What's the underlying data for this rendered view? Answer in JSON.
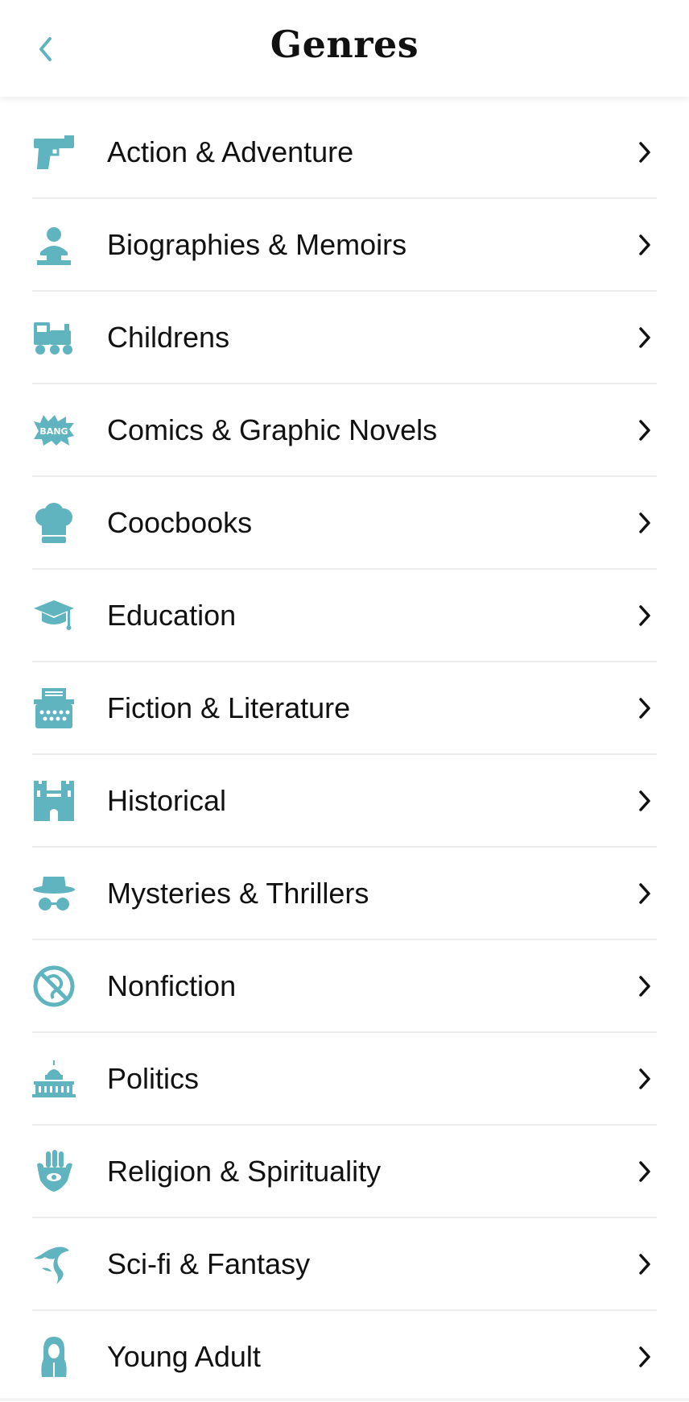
{
  "header": {
    "title": "Genres"
  },
  "colors": {
    "accent": "#5fb4bf",
    "text": "#111111",
    "divider": "#ececec"
  },
  "genres": [
    {
      "label": "Action & Adventure",
      "icon": "gun-icon"
    },
    {
      "label": "Biographies & Memoirs",
      "icon": "bust-icon"
    },
    {
      "label": "Childrens",
      "icon": "toy-train-icon"
    },
    {
      "label": "Comics & Graphic Novels",
      "icon": "bang-icon"
    },
    {
      "label": "Coocbooks",
      "icon": "chef-hat-icon"
    },
    {
      "label": "Education",
      "icon": "graduation-cap-icon"
    },
    {
      "label": "Fiction & Literature",
      "icon": "typewriter-icon"
    },
    {
      "label": "Historical",
      "icon": "castle-icon"
    },
    {
      "label": "Mysteries & Thrillers",
      "icon": "detective-icon"
    },
    {
      "label": "Nonfiction",
      "icon": "no-dragon-icon"
    },
    {
      "label": "Politics",
      "icon": "capitol-icon"
    },
    {
      "label": "Religion & Spirituality",
      "icon": "hamsa-icon"
    },
    {
      "label": "Sci-fi & Fantasy",
      "icon": "dragon-icon"
    },
    {
      "label": "Young Adult",
      "icon": "hooded-teen-icon"
    }
  ]
}
